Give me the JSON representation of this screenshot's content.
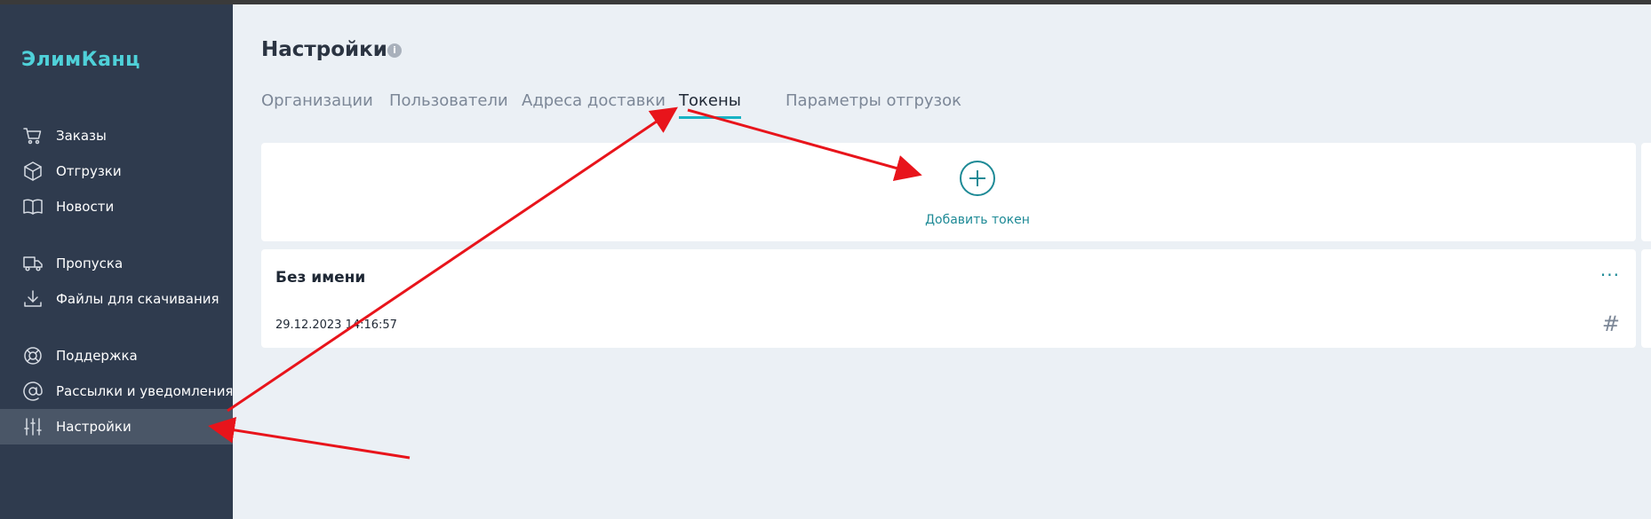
{
  "brand": {
    "logo_text": "ЭлимКанц"
  },
  "sidebar": {
    "items": [
      {
        "label": "Заказы",
        "icon": "cart-icon"
      },
      {
        "label": "Отгрузки",
        "icon": "box-icon"
      },
      {
        "label": "Новости",
        "icon": "book-icon"
      },
      {
        "label": "Пропуска",
        "icon": "truck-icon"
      },
      {
        "label": "Файлы для скачивания",
        "icon": "download-icon"
      },
      {
        "label": "Поддержка",
        "icon": "lifebuoy-icon"
      },
      {
        "label": "Рассылки и уведомления",
        "icon": "at-icon"
      },
      {
        "label": "Настройки",
        "icon": "sliders-icon",
        "active": true
      }
    ]
  },
  "page": {
    "title": "Настройки",
    "info_icon": "i"
  },
  "tabs": [
    {
      "label": "Организации"
    },
    {
      "label": "Пользователи"
    },
    {
      "label": "Адреса доставки"
    },
    {
      "label": "Токены",
      "active": true
    },
    {
      "label": "Параметры отгрузок"
    }
  ],
  "add_token": {
    "label": "Добавить токен"
  },
  "tokens": [
    {
      "name": "Без имени",
      "date": "29.12.2023 14:16:57",
      "menu": "···",
      "hash_icon": "#"
    }
  ],
  "colors": {
    "sidebar_bg": "#2f3b4e",
    "accent": "#17b3c4",
    "annotation": "#e8141b"
  }
}
